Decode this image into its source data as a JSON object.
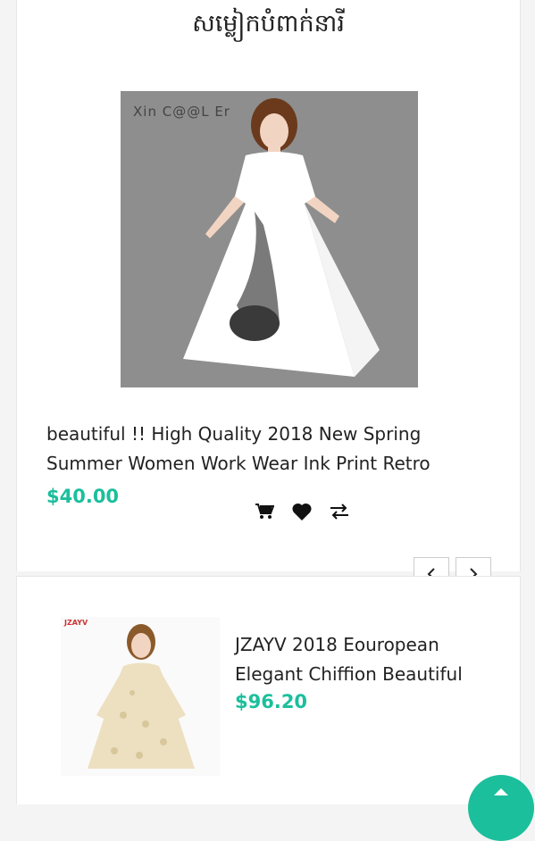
{
  "section": {
    "title": "សម្លៀកបំពាក់នារី"
  },
  "featured": {
    "brand": "Xin C@@L Er",
    "description": "beautiful !! High Quality 2018 New Spring Summer Women Work Wear Ink Print Retro",
    "price": "$40.00"
  },
  "actions": {
    "icons": [
      "cart-icon",
      "heart-icon",
      "compare-icon"
    ]
  },
  "carousel": {
    "prev_icon": "chevron-left-icon",
    "next_icon": "chevron-right-icon"
  },
  "list_item": {
    "brand": "JZAYV",
    "description": "JZAYV 2018 Eouropean Elegant Chiffion Beautiful",
    "price": "$96.20"
  },
  "fab": {
    "icon": "arrow-up-icon"
  },
  "colors": {
    "accent": "#1bbf9c",
    "text": "#222222"
  }
}
